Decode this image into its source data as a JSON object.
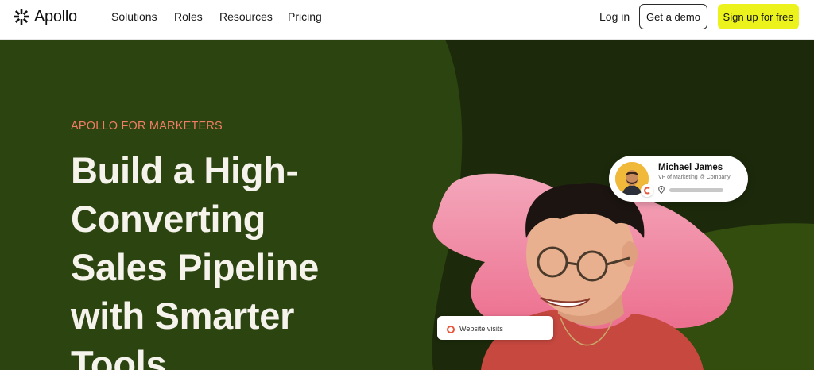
{
  "nav": {
    "logo_text": "Apollo",
    "links": [
      "Solutions",
      "Roles",
      "Resources",
      "Pricing"
    ],
    "login_label": "Log in",
    "demo_label": "Get a demo",
    "signup_label": "Sign up for free"
  },
  "hero": {
    "eyebrow": "APOLLO FOR MARKETERS",
    "headline_lines": [
      "Build a High-",
      "Converting",
      "Sales Pipeline",
      "with Smarter",
      "Tools"
    ]
  },
  "profile_card": {
    "name": "Michael James",
    "title": "VP of Marketing @ Company"
  },
  "peek_card": {
    "text": "Website visits"
  },
  "colors": {
    "accent_yellow": "#ebf21c",
    "hero_green": "#1c2a0b",
    "eyebrow_coral": "#f07d65",
    "pink_shape": "#f089a6"
  },
  "icons": [
    "apollo-logo-icon",
    "location-pin-icon",
    "apollo-badge-icon",
    "target-icon"
  ]
}
